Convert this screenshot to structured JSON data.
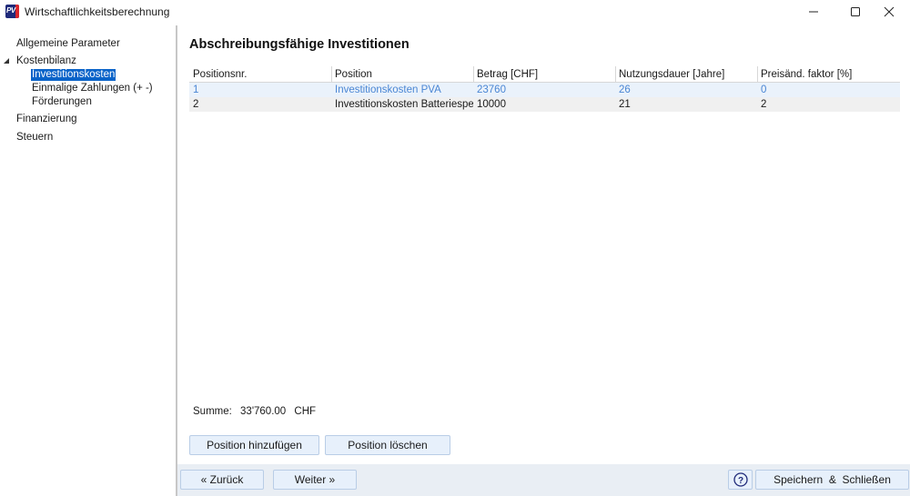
{
  "window": {
    "title": "Wirtschaftlichkeitsberechnung",
    "icon_text": "PV",
    "controls": [
      "minimize-icon",
      "maximize-icon",
      "close-icon"
    ]
  },
  "nav": {
    "items": [
      {
        "label": "Allgemeine Parameter",
        "level": 0
      },
      {
        "label": "Kostenbilanz",
        "level": 0,
        "expanded": true
      },
      {
        "label": "Investitionskosten",
        "level": 1,
        "selected": true
      },
      {
        "label": "Einmalige Zahlungen (+ -)",
        "level": 1
      },
      {
        "label": "Förderungen",
        "level": 1
      },
      {
        "label": "Finanzierung",
        "level": 0
      },
      {
        "label": "Steuern",
        "level": 0
      }
    ]
  },
  "main": {
    "title": "Abschreibungsfähige Investitionen",
    "table": {
      "headers": [
        "Positionsnr.",
        "Position",
        "Betrag [CHF]",
        "Nutzungsdauer [Jahre]",
        "Preisänd. faktor [%]"
      ],
      "rows": [
        [
          "1",
          "Investitionskosten PVA",
          "23760",
          "26",
          "0"
        ],
        [
          "2",
          "Investitionskosten Batteriespei",
          "10000",
          "21",
          "2"
        ]
      ]
    },
    "summe_label": "Summe:",
    "summe_value": "33'760.00",
    "summe_unit": "CHF",
    "add_button": "Position hinzufügen",
    "delete_button": "Position löschen"
  },
  "footer": {
    "back_button": "« Zurück",
    "next_button": "Weiter »",
    "help_icon": "question-circle-icon",
    "save_button": "Speichern  &  Schließen"
  },
  "colors": {
    "selection": "#0a63c9",
    "selected_row_text": "#4a86d4",
    "button_bg": "#e7f0fb",
    "footer_bg": "#e9eef4"
  }
}
